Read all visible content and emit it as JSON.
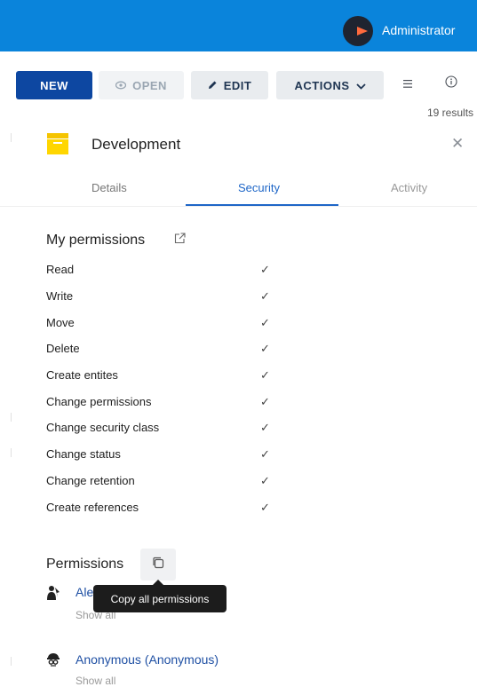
{
  "header": {
    "user_name": "Administrator",
    "brand_color": "#0a84db"
  },
  "toolbar": {
    "new_label": "NEW",
    "open_label": "OPEN",
    "edit_label": "EDIT",
    "actions_label": "ACTIONS",
    "results_text": "19 results"
  },
  "panel": {
    "title": "Development",
    "tabs": [
      {
        "label": "Details"
      },
      {
        "label": "Security",
        "active": true
      },
      {
        "label": "Activity"
      }
    ]
  },
  "my_permissions": {
    "title": "My permissions",
    "items": [
      {
        "label": "Read",
        "granted": true
      },
      {
        "label": "Write",
        "granted": true
      },
      {
        "label": "Move",
        "granted": true
      },
      {
        "label": "Delete",
        "granted": true
      },
      {
        "label": "Create entites",
        "granted": true
      },
      {
        "label": "Change permissions",
        "granted": true
      },
      {
        "label": "Change security class",
        "granted": true
      },
      {
        "label": "Change status",
        "granted": true
      },
      {
        "label": "Change retention",
        "granted": true
      },
      {
        "label": "Create references",
        "granted": true
      }
    ],
    "check_glyph": "✓"
  },
  "permissions": {
    "title": "Permissions",
    "copy_tooltip": "Copy all permissions",
    "principals": [
      {
        "name": "Ale",
        "show_all": "Show all"
      },
      {
        "name": "Anonymous (Anonymous)",
        "show_all": "Show all"
      }
    ]
  }
}
